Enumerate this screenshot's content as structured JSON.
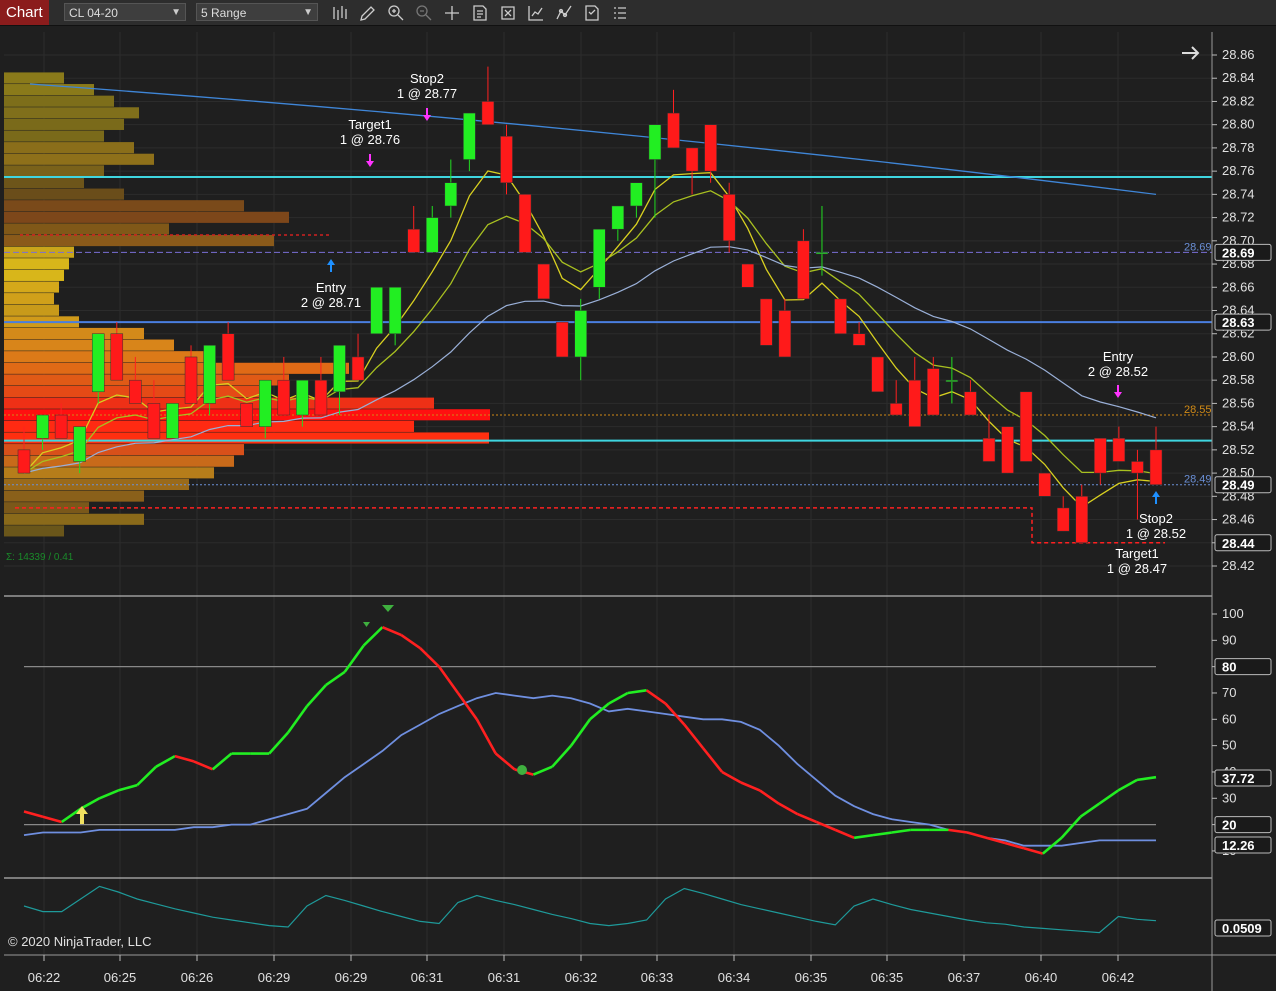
{
  "toolbar": {
    "tab": "Chart",
    "instrument": "CL 04-20",
    "interval": "5 Range",
    "icons": [
      "bars-type-icon",
      "draw-tool-icon",
      "zoom-in-icon",
      "zoom-out-icon",
      "crosshair-icon",
      "data-box-icon",
      "properties-icon",
      "indicators-icon",
      "strategies-icon",
      "templates-icon"
    ]
  },
  "copyright": "© 2020 NinjaTrader, LLC",
  "volume_profile_stat": "Σ: 14339 / 0.41",
  "price_axis": {
    "ticks": [
      "28.86",
      "28.84",
      "28.82",
      "28.80",
      "28.78",
      "28.76",
      "28.74",
      "28.72",
      "28.70",
      "28.68",
      "28.66",
      "28.64",
      "28.62",
      "28.60",
      "28.58",
      "28.56",
      "28.54",
      "28.52",
      "28.50",
      "28.48",
      "28.46",
      "28.44",
      "28.42"
    ],
    "tags": [
      {
        "value": "28.69",
        "color": "#ffffff"
      },
      {
        "value": "28.63",
        "color": "#ffffff"
      },
      {
        "value": "28.49",
        "color": "#ffffff"
      },
      {
        "value": "28.44",
        "color": "#ffffff"
      }
    ],
    "line_labels": [
      {
        "value": "28.69",
        "color": "#6a8fd6"
      },
      {
        "value": "28.55",
        "color": "#d08a16"
      },
      {
        "value": "28.49",
        "color": "#6a8fd6"
      }
    ]
  },
  "oscillator_axis": {
    "ticks": [
      "100",
      "90",
      "80",
      "70",
      "60",
      "50",
      "40",
      "30",
      "20",
      "10"
    ],
    "tags": [
      "80",
      "37.72",
      "20",
      "12.26"
    ]
  },
  "third_axis": {
    "tags": [
      "0.0509"
    ]
  },
  "time_axis": [
    "06:22",
    "06:25",
    "06:26",
    "06:29",
    "06:29",
    "06:31",
    "06:31",
    "06:32",
    "06:33",
    "06:34",
    "06:35",
    "06:35",
    "06:37",
    "06:40",
    "06:42"
  ],
  "trade_labels": [
    {
      "title": "Stop2",
      "detail": "1 @ 28.77"
    },
    {
      "title": "Target1",
      "detail": "1 @ 28.76"
    },
    {
      "title": "Entry",
      "detail": "2 @ 28.71"
    },
    {
      "title": "Entry",
      "detail": "2 @ 28.52"
    },
    {
      "title": "Stop2",
      "detail": "1 @ 28.52"
    },
    {
      "title": "Target1",
      "detail": "1 @ 28.47"
    }
  ],
  "chart_data": {
    "type": "candlestick",
    "x": [
      "06:22",
      "06:25",
      "06:26",
      "06:29",
      "06:29",
      "06:31",
      "06:31",
      "06:32",
      "06:33",
      "06:34",
      "06:35",
      "06:35",
      "06:37",
      "06:40",
      "06:42"
    ],
    "ylim": [
      28.4,
      28.88
    ],
    "candles": [
      {
        "o": 28.52,
        "h": 28.54,
        "l": 28.5,
        "c": 28.5
      },
      {
        "o": 28.53,
        "h": 28.55,
        "l": 28.52,
        "c": 28.55
      },
      {
        "o": 28.55,
        "h": 28.56,
        "l": 28.53,
        "c": 28.53
      },
      {
        "o": 28.51,
        "h": 28.54,
        "l": 28.5,
        "c": 28.54
      },
      {
        "o": 28.57,
        "h": 28.62,
        "l": 28.56,
        "c": 28.62
      },
      {
        "o": 28.62,
        "h": 28.63,
        "l": 28.58,
        "c": 28.58
      },
      {
        "o": 28.58,
        "h": 28.6,
        "l": 28.56,
        "c": 28.56
      },
      {
        "o": 28.56,
        "h": 28.58,
        "l": 28.53,
        "c": 28.53
      },
      {
        "o": 28.53,
        "h": 28.56,
        "l": 28.53,
        "c": 28.56
      },
      {
        "o": 28.6,
        "h": 28.61,
        "l": 28.56,
        "c": 28.56
      },
      {
        "o": 28.56,
        "h": 28.61,
        "l": 28.55,
        "c": 28.61
      },
      {
        "o": 28.62,
        "h": 28.63,
        "l": 28.58,
        "c": 28.58
      },
      {
        "o": 28.56,
        "h": 28.56,
        "l": 28.54,
        "c": 28.54
      },
      {
        "o": 28.54,
        "h": 28.58,
        "l": 28.53,
        "c": 28.58
      },
      {
        "o": 28.58,
        "h": 28.6,
        "l": 28.55,
        "c": 28.55
      },
      {
        "o": 28.55,
        "h": 28.58,
        "l": 28.54,
        "c": 28.58
      },
      {
        "o": 28.58,
        "h": 28.6,
        "l": 28.55,
        "c": 28.55
      },
      {
        "o": 28.57,
        "h": 28.61,
        "l": 28.55,
        "c": 28.61
      },
      {
        "o": 28.6,
        "h": 28.62,
        "l": 28.58,
        "c": 28.58
      },
      {
        "o": 28.62,
        "h": 28.66,
        "l": 28.62,
        "c": 28.66
      },
      {
        "o": 28.62,
        "h": 28.66,
        "l": 28.61,
        "c": 28.66
      },
      {
        "o": 28.71,
        "h": 28.73,
        "l": 28.69,
        "c": 28.69
      },
      {
        "o": 28.69,
        "h": 28.73,
        "l": 28.69,
        "c": 28.72
      },
      {
        "o": 28.73,
        "h": 28.77,
        "l": 28.72,
        "c": 28.75
      },
      {
        "o": 28.77,
        "h": 28.8,
        "l": 28.76,
        "c": 28.81
      },
      {
        "o": 28.82,
        "h": 28.85,
        "l": 28.81,
        "c": 28.8
      },
      {
        "o": 28.79,
        "h": 28.8,
        "l": 28.74,
        "c": 28.75
      },
      {
        "o": 28.74,
        "h": 28.74,
        "l": 28.69,
        "c": 28.69
      },
      {
        "o": 28.68,
        "h": 28.68,
        "l": 28.65,
        "c": 28.65
      },
      {
        "o": 28.63,
        "h": 28.63,
        "l": 28.6,
        "c": 28.6
      },
      {
        "o": 28.6,
        "h": 28.65,
        "l": 28.58,
        "c": 28.64
      },
      {
        "o": 28.66,
        "h": 28.71,
        "l": 28.65,
        "c": 28.71
      },
      {
        "o": 28.71,
        "h": 28.73,
        "l": 28.7,
        "c": 28.73
      },
      {
        "o": 28.73,
        "h": 28.75,
        "l": 28.72,
        "c": 28.75
      },
      {
        "o": 28.77,
        "h": 28.79,
        "l": 28.72,
        "c": 28.8
      },
      {
        "o": 28.81,
        "h": 28.83,
        "l": 28.79,
        "c": 28.78
      },
      {
        "o": 28.78,
        "h": 28.78,
        "l": 28.74,
        "c": 28.76
      },
      {
        "o": 28.8,
        "h": 28.8,
        "l": 28.75,
        "c": 28.76
      },
      {
        "o": 28.74,
        "h": 28.75,
        "l": 28.69,
        "c": 28.7
      },
      {
        "o": 28.68,
        "h": 28.68,
        "l": 28.66,
        "c": 28.66
      },
      {
        "o": 28.65,
        "h": 28.65,
        "l": 28.61,
        "c": 28.61
      },
      {
        "o": 28.64,
        "h": 28.65,
        "l": 28.6,
        "c": 28.6
      },
      {
        "o": 28.7,
        "h": 28.71,
        "l": 28.65,
        "c": 28.65
      },
      {
        "o": 28.69,
        "h": 28.73,
        "l": 28.67,
        "c": 28.69
      },
      {
        "o": 28.65,
        "h": 28.65,
        "l": 28.62,
        "c": 28.62
      },
      {
        "o": 28.62,
        "h": 28.63,
        "l": 28.61,
        "c": 28.61
      },
      {
        "o": 28.6,
        "h": 28.6,
        "l": 28.58,
        "c": 28.57
      },
      {
        "o": 28.56,
        "h": 28.58,
        "l": 28.55,
        "c": 28.55
      },
      {
        "o": 28.58,
        "h": 28.6,
        "l": 28.54,
        "c": 28.54
      },
      {
        "o": 28.59,
        "h": 28.6,
        "l": 28.55,
        "c": 28.55
      },
      {
        "o": 28.58,
        "h": 28.6,
        "l": 28.56,
        "c": 28.58
      },
      {
        "o": 28.57,
        "h": 28.58,
        "l": 28.55,
        "c": 28.55
      },
      {
        "o": 28.53,
        "h": 28.55,
        "l": 28.51,
        "c": 28.51
      },
      {
        "o": 28.54,
        "h": 28.54,
        "l": 28.5,
        "c": 28.5
      },
      {
        "o": 28.57,
        "h": 28.57,
        "l": 28.51,
        "c": 28.51
      },
      {
        "o": 28.5,
        "h": 28.5,
        "l": 28.48,
        "c": 28.48
      },
      {
        "o": 28.47,
        "h": 28.48,
        "l": 28.45,
        "c": 28.45
      },
      {
        "o": 28.48,
        "h": 28.49,
        "l": 28.44,
        "c": 28.44
      },
      {
        "o": 28.53,
        "h": 28.53,
        "l": 28.49,
        "c": 28.5
      },
      {
        "o": 28.53,
        "h": 28.54,
        "l": 28.51,
        "c": 28.51
      },
      {
        "o": 28.51,
        "h": 28.52,
        "l": 28.46,
        "c": 28.5
      },
      {
        "o": 28.52,
        "h": 28.54,
        "l": 28.49,
        "c": 28.49
      }
    ],
    "horizontal_levels": [
      {
        "value": 28.755,
        "color": "#3fd6e0"
      },
      {
        "value": 28.69,
        "color": "#7a6fd6"
      },
      {
        "value": 28.63,
        "color": "#4a7fe0"
      },
      {
        "value": 28.528,
        "color": "#3fd6e0"
      },
      {
        "value": 28.55,
        "color": "#d08a16"
      },
      {
        "value": 28.49,
        "color": "#6a8fd6"
      }
    ],
    "oscillator": {
      "ylim": [
        0,
        105
      ],
      "levels": [
        80,
        20
      ],
      "fast": [
        25,
        23,
        21,
        26,
        30,
        33,
        35,
        42,
        46,
        44,
        41,
        47,
        47,
        47,
        55,
        65,
        73,
        78,
        88,
        95,
        92,
        87,
        80,
        70,
        60,
        47,
        41,
        39,
        42,
        50,
        60,
        66,
        70,
        71,
        66,
        58,
        49,
        40,
        36,
        33,
        28,
        24,
        21,
        18,
        15,
        16,
        17,
        18,
        18,
        18,
        17,
        15,
        13,
        11,
        9,
        15,
        23,
        28,
        33,
        37,
        38
      ],
      "slow": [
        16,
        17,
        17,
        17,
        18,
        18,
        18,
        18,
        18,
        19,
        19,
        20,
        20,
        22,
        24,
        26,
        32,
        38,
        43,
        48,
        54,
        58,
        62,
        65,
        68,
        70,
        69,
        68,
        69,
        68,
        66,
        63,
        64,
        63,
        62,
        61,
        60,
        60,
        59,
        56,
        50,
        43,
        37,
        31,
        27,
        24,
        22,
        21,
        20,
        18,
        17,
        15,
        14,
        12,
        12,
        12,
        13,
        14,
        14,
        14,
        14
      ]
    },
    "third_panel": {
      "ylim": [
        0,
        0.1
      ],
      "values": [
        0.07,
        0.062,
        0.062,
        0.08,
        0.098,
        0.09,
        0.08,
        0.073,
        0.066,
        0.06,
        0.054,
        0.05,
        0.046,
        0.042,
        0.04,
        0.07,
        0.085,
        0.078,
        0.07,
        0.062,
        0.055,
        0.048,
        0.045,
        0.075,
        0.085,
        0.078,
        0.072,
        0.065,
        0.058,
        0.052,
        0.045,
        0.042,
        0.045,
        0.05,
        0.08,
        0.095,
        0.088,
        0.08,
        0.072,
        0.066,
        0.06,
        0.054,
        0.048,
        0.043,
        0.07,
        0.08,
        0.072,
        0.065,
        0.06,
        0.055,
        0.05,
        0.046,
        0.044,
        0.04,
        0.038,
        0.036,
        0.034,
        0.032,
        0.055,
        0.051,
        0.049
      ]
    }
  }
}
